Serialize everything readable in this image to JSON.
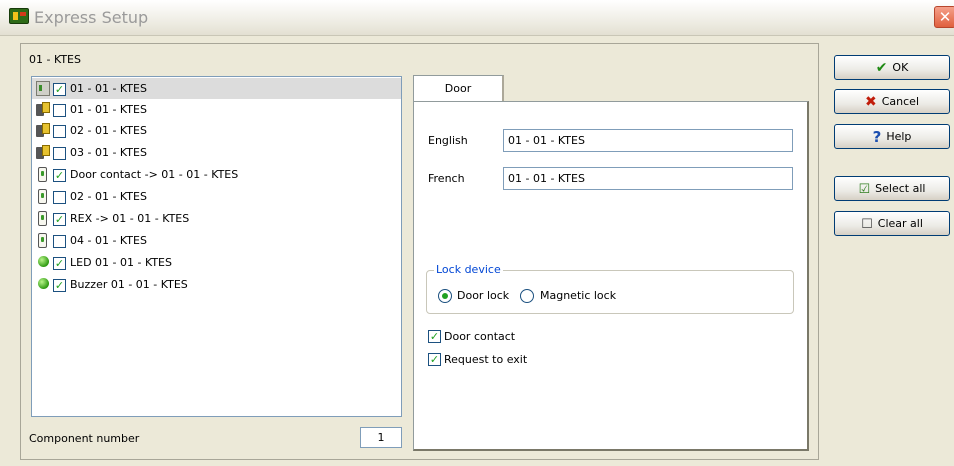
{
  "window": {
    "title": "Express Setup",
    "close_glyph": "✕"
  },
  "main": {
    "label": "01 - KTES"
  },
  "tree": {
    "items": [
      {
        "icon": "controller-icon",
        "checked": true,
        "label": "01 - 01 - KTES",
        "selected": true
      },
      {
        "icon": "reader-icon",
        "checked": false,
        "label": "01 - 01 - KTES"
      },
      {
        "icon": "reader-icon",
        "checked": false,
        "label": "02 - 01 - KTES"
      },
      {
        "icon": "reader-icon",
        "checked": false,
        "label": "03 - 01 - KTES"
      },
      {
        "icon": "input-icon",
        "checked": true,
        "label": "Door contact -> 01 - 01 - KTES"
      },
      {
        "icon": "input-icon",
        "checked": false,
        "label": "02 - 01 - KTES"
      },
      {
        "icon": "input-icon",
        "checked": true,
        "label": "REX -> 01 - 01 - KTES"
      },
      {
        "icon": "input-icon",
        "checked": false,
        "label": "04 - 01 - KTES"
      },
      {
        "icon": "led-icon",
        "checked": true,
        "label": "LED 01 - 01 - KTES"
      },
      {
        "icon": "led-icon",
        "checked": true,
        "label": "Buzzer 01 - 01 - KTES"
      }
    ]
  },
  "component": {
    "label": "Component number",
    "value": "1"
  },
  "door_tab": {
    "tab_label": "Door",
    "english_label": "English",
    "english_value": "01 - 01 - KTES",
    "french_label": "French",
    "french_value": "01 - 01 - KTES",
    "lock_device": {
      "title": "Lock device",
      "options": [
        "Door lock",
        "Magnetic lock"
      ],
      "selected": "Door lock"
    },
    "door_contact_label": "Door contact",
    "door_contact_checked": true,
    "request_to_exit_label": "Request to exit",
    "request_to_exit_checked": true
  },
  "buttons": {
    "ok": "OK",
    "cancel": "Cancel",
    "help": "Help",
    "select_all": "Select all",
    "clear_all": "Clear all"
  },
  "colors": {
    "background": "#ece9d8",
    "check_green": "#21a121",
    "group_title_blue": "#0046d5"
  }
}
